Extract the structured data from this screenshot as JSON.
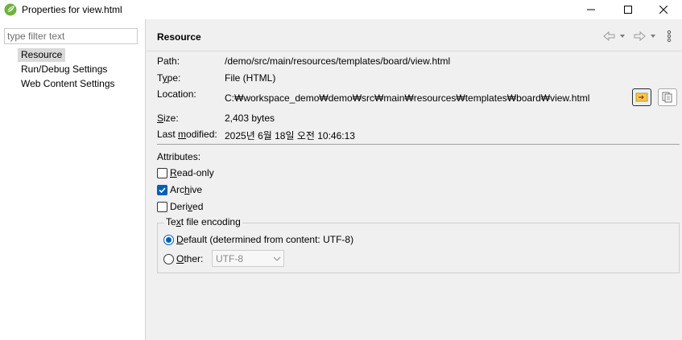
{
  "window": {
    "title": "Properties for view.html",
    "minimize_label": "—",
    "maximize_label": "☐",
    "close_label": "✕"
  },
  "filter": {
    "placeholder": "type filter text"
  },
  "tree": {
    "items": [
      {
        "label": "Resource",
        "selected": true
      },
      {
        "label": "Run/Debug Settings",
        "selected": false
      },
      {
        "label": "Web Content Settings",
        "selected": false
      }
    ]
  },
  "header": {
    "title": "Resource"
  },
  "details": {
    "path_label_pre": "Path",
    "path_label_post": ":",
    "path_value": "/demo/src/main/resources/templates/board/view.html",
    "type_label_pre": "T",
    "type_label_ul": "y",
    "type_label_post": "pe:",
    "type_value": "File  (HTML)",
    "location_label": "Location:",
    "location_value": "C:₩workspace_demo₩demo₩src₩main₩resources₩templates₩board₩view.html",
    "size_label_ul": "S",
    "size_label_post": "ize:",
    "size_value": "2,403  bytes",
    "modified_label_pre": "Last ",
    "modified_label_ul": "m",
    "modified_label_post": "odified:",
    "modified_value": "2025년 6월 18일 오전 10:46:13"
  },
  "attributes": {
    "title": "Attributes:",
    "read_only": {
      "ul": "R",
      "rest": "ead-only",
      "checked": false
    },
    "archive": {
      "pre": "Arc",
      "ul": "h",
      "rest": "ive",
      "checked": true
    },
    "derived": {
      "pre": "Deri",
      "ul": "v",
      "rest": "ed",
      "checked": false
    }
  },
  "encoding": {
    "title_pre": "Te",
    "title_ul": "x",
    "title_post": "t file encoding",
    "default_ul": "D",
    "default_rest": "efault (determined from content: UTF-8)",
    "default_selected": true,
    "other_ul": "O",
    "other_rest": "ther:",
    "other_selected": false,
    "other_value": "UTF-8"
  },
  "colors": {
    "accent": "#005fb8",
    "app_icon": "#4caf50",
    "explorer_button": "#f0b400"
  },
  "icons": {
    "app": "eclipse-spring-icon",
    "back": "back-arrow-icon",
    "forward": "forward-arrow-icon",
    "menu": "view-menu-icon",
    "show_in_explorer": "folder-arrow-icon",
    "copy_path": "copy-icon"
  }
}
